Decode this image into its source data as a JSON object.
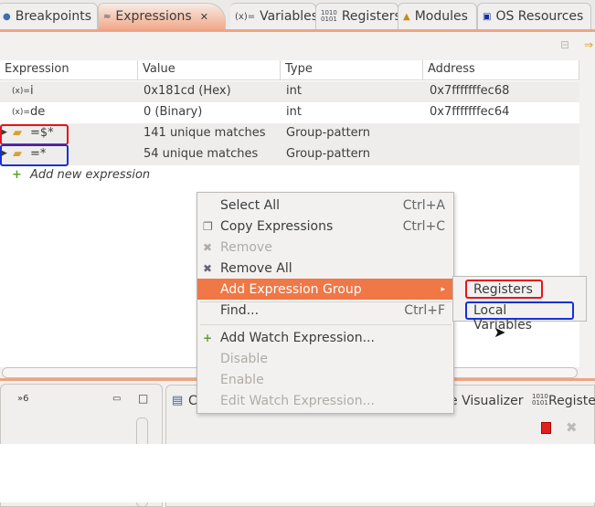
{
  "tabs": [
    {
      "label": "Breakpoints",
      "icon": "breakpoints-icon"
    },
    {
      "label": "Expressions",
      "icon": "expressions-icon",
      "active": true
    },
    {
      "label": "Variables",
      "icon": "variables-icon"
    },
    {
      "label": "Registers",
      "icon": "registers-icon"
    },
    {
      "label": "Modules",
      "icon": "modules-icon"
    },
    {
      "label": "OS Resources",
      "icon": "os-resources-icon"
    }
  ],
  "table": {
    "columns": [
      "Expression",
      "Value",
      "Type",
      "Address"
    ],
    "rows": [
      {
        "expression": "i",
        "value": "0x181cd (Hex)",
        "type": "int",
        "address": "0x7fffffffec68"
      },
      {
        "expression": "de",
        "value": "0 (Binary)",
        "type": "int",
        "address": "0x7fffffffec64"
      },
      {
        "expression": "=$*",
        "value": "141 unique matches",
        "type": "Group-pattern",
        "address": ""
      },
      {
        "expression": "=*",
        "value": "54 unique matches",
        "type": "Group-pattern",
        "address": ""
      }
    ],
    "add_new": "Add new expression"
  },
  "context_menu": {
    "items": [
      {
        "label": "Select All",
        "shortcut": "Ctrl+A"
      },
      {
        "label": "Copy Expressions",
        "shortcut": "Ctrl+C"
      },
      {
        "label": "Remove",
        "disabled": true
      },
      {
        "label": "Remove All"
      },
      {
        "label": "Add Expression Group",
        "submenu": "▸"
      },
      {
        "label": "Find...",
        "shortcut": "Ctrl+F"
      },
      {
        "label": "Add Watch Expression..."
      },
      {
        "label": "Disable",
        "disabled": true
      },
      {
        "label": "Enable",
        "disabled": true
      },
      {
        "label": "Edit Watch Expression...",
        "disabled": true
      }
    ]
  },
  "submenu": {
    "items": [
      "Registers",
      "Local Variables"
    ]
  },
  "bottom": {
    "left_overflow": "»6",
    "right_tab_partial": "C",
    "visualizer_tab": "e Visualizer",
    "registers_tab": "Registe"
  },
  "colors": {
    "accent": "#f07746",
    "red_box": "#e8141c",
    "blue_box": "#1530d8"
  }
}
